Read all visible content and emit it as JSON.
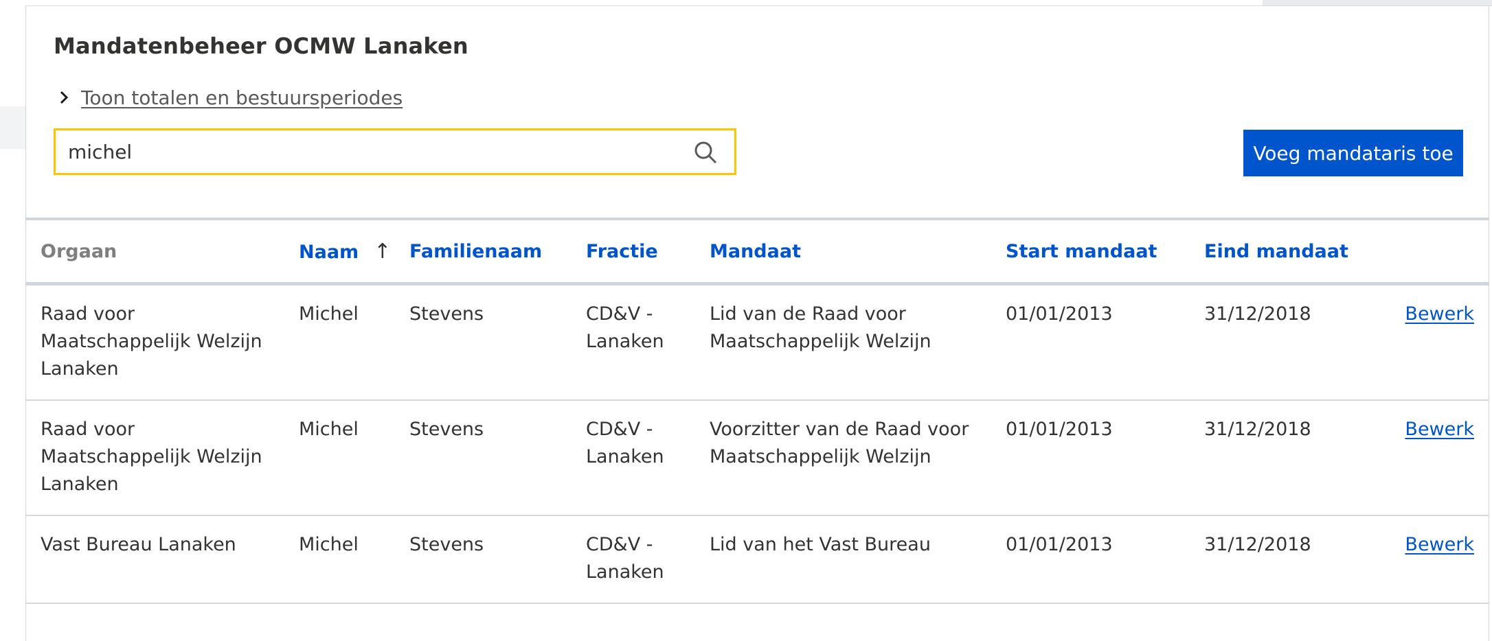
{
  "page": {
    "title": "Mandatenbeheer OCMW Lanaken",
    "toggle_label": "Toon totalen en bestuursperiodes",
    "search_value": "michel",
    "add_button_label": "Voeg mandataris toe"
  },
  "table": {
    "headers": {
      "orgaan": "Orgaan",
      "naam": "Naam",
      "sort_arrow": "↑",
      "familienaam": "Familienaam",
      "fractie": "Fractie",
      "mandaat": "Mandaat",
      "start": "Start mandaat",
      "eind": "Eind mandaat"
    },
    "rows": [
      {
        "orgaan": "Raad voor Maatschappelijk Welzijn Lanaken",
        "naam": "Michel",
        "familienaam": "Stevens",
        "fractie": "CD&V - Lanaken",
        "mandaat": "Lid van de Raad voor Maatschappelijk Welzijn",
        "start": "01/01/2013",
        "eind": "31/12/2018",
        "action": "Bewerk"
      },
      {
        "orgaan": "Raad voor Maatschappelijk Welzijn Lanaken",
        "naam": "Michel",
        "familienaam": "Stevens",
        "fractie": "CD&V - Lanaken",
        "mandaat": "Voorzitter van de Raad voor Maatschappelijk Welzijn",
        "start": "01/01/2013",
        "eind": "31/12/2018",
        "action": "Bewerk"
      },
      {
        "orgaan": "Vast Bureau Lanaken",
        "naam": "Michel",
        "familienaam": "Stevens",
        "fractie": "CD&V - Lanaken",
        "mandaat": "Lid van het Vast Bureau",
        "start": "01/01/2013",
        "eind": "31/12/2018",
        "action": "Bewerk"
      }
    ]
  },
  "icons": {
    "chevron": "chevron-right-icon",
    "search": "search-icon"
  },
  "colors": {
    "accent": "#0055cc",
    "search_focus": "#fdc500",
    "text": "#333332"
  }
}
